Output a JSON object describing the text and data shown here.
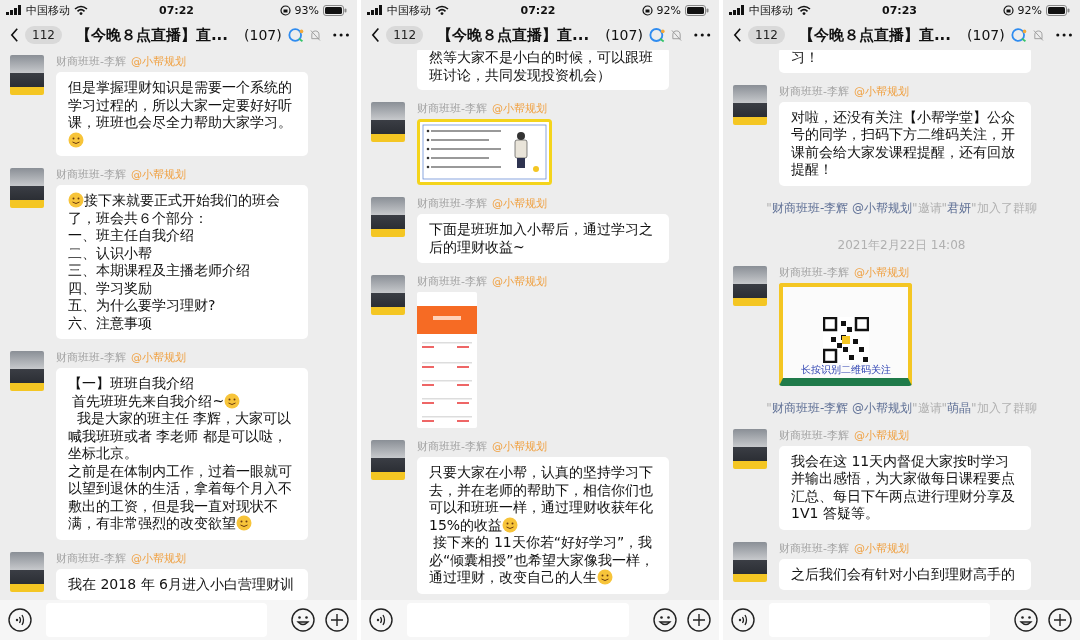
{
  "phones": [
    {
      "status": {
        "carrier": "中国移动",
        "time": "07:22",
        "battery": "93%"
      },
      "header": {
        "back_count": "112",
        "title": "【今晚８点直播】直...",
        "member_count": "(107)"
      },
      "messages": [
        {
          "kind": "text",
          "sender": "财商班班-李辉",
          "mention": "@小帮规划",
          "rows": [
            [
              "但是掌握理财知识是需要一个系统的学习过程的，所以大家一定要好好听课，班班也会尽全力帮助大家学习。"
            ],
            [
              {
                "kind": "emoji"
              }
            ]
          ]
        },
        {
          "kind": "text",
          "sender": "财商班班-李辉",
          "mention": "@小帮规划",
          "rows": [
            [
              {
                "kind": "emoji"
              },
              "接下来就要正式开始我们的班会"
            ],
            [
              "了，班会共６个部分："
            ],
            [
              "一、班主任自我介绍"
            ],
            [
              "二、认识小帮"
            ],
            [
              "三、本期课程及主播老师介绍"
            ],
            [
              "四、学习奖励"
            ],
            [
              "五、为什么要学习理财?"
            ],
            [
              "六、注意事项"
            ]
          ]
        },
        {
          "kind": "text",
          "sender": "财商班班-李辉",
          "mention": "@小帮规划",
          "rows": [
            [
              "【一】班班自我介绍"
            ],
            [
              " 首先班班先来自我介绍~",
              {
                "kind": "emoji"
              }
            ],
            [
              "  我是大家的班主任 李辉，大家可以喊我班班或者 李老师 都是可以哒，坐标北京。"
            ],
            [
              "之前是在体制内工作，过着一眼就可以望到退休的生活，拿着每个月入不敷出的工资，但是我一直对现状不"
            ],
            [
              "满，有非常强烈的改变欲望",
              {
                "kind": "emoji"
              }
            ]
          ]
        },
        {
          "kind": "text",
          "sender": "财商班班-李辉",
          "mention": "@小帮规划",
          "rows": [
            [
              "我在 2018 年 6月进入小白营理财训"
            ]
          ]
        }
      ]
    },
    {
      "status": {
        "carrier": "中国移动",
        "time": "07:22",
        "battery": "92%"
      },
      "header": {
        "back_count": "112",
        "title": "【今晚８点直播】直...",
        "member_count": "(107)"
      },
      "messages": [
        {
          "kind": "text",
          "rows": [
            [
              "然等大家不是小白的时候，可以跟班班讨论，共同发现投资机会）"
            ]
          ]
        },
        {
          "kind": "slide_image",
          "sender": "财商班班-李辉",
          "mention": "@小帮规划"
        },
        {
          "kind": "text",
          "sender": "财商班班-李辉",
          "mention": "@小帮规划",
          "rows": [
            [
              "下面是班班加入小帮后，通过学习之后的理财收益~"
            ]
          ]
        },
        {
          "kind": "screenshot_image",
          "sender": "财商班班-李辉",
          "mention": "@小帮规划"
        },
        {
          "kind": "text",
          "sender": "财商班班-李辉",
          "mention": "@小帮规划",
          "rows": [
            [
              "只要大家在小帮，认真的坚持学习下去，并在老师的帮助下，相信你们也可以和班班一样，通过理财收获年化"
            ],
            [
              "15%的收益",
              {
                "kind": "emoji"
              }
            ],
            [
              " 接下来的 11天你若“好好学习”，我必“倾囊相授”也希望大家像我一样，"
            ],
            [
              "通过理财，改变自己的人生",
              {
                "kind": "emoji"
              }
            ]
          ]
        }
      ]
    },
    {
      "status": {
        "carrier": "中国移动",
        "time": "07:23",
        "battery": "92%"
      },
      "header": {
        "back_count": "112",
        "title": "【今晚８点直播】直...",
        "member_count": "(107)"
      },
      "messages": [
        {
          "kind": "text",
          "rows": [
            [
              "习！"
            ]
          ]
        },
        {
          "kind": "text",
          "sender": "财商班班-李辉",
          "mention": "@小帮规划",
          "rows": [
            [
              "对啦，还没有关注【小帮学堂】公众号的同学，扫码下方二维码关注，开课前会给大家发课程提醒，还有回放提醒！"
            ]
          ]
        },
        {
          "kind": "system",
          "parts": [
            {
              "text": "\"",
              "link": false
            },
            {
              "text": "财商班班-李辉 @小帮规划",
              "link": true
            },
            {
              "text": "\"邀请\"",
              "link": false
            },
            {
              "text": "君妍",
              "link": true
            },
            {
              "text": "\"加入了群聊",
              "link": false
            }
          ]
        },
        {
          "kind": "time",
          "text": "2021年2月22日 14:08"
        },
        {
          "kind": "poster_image",
          "caption": "长按识别二维码关注",
          "sender": "财商班班-李辉",
          "mention": "@小帮规划"
        },
        {
          "kind": "system",
          "parts": [
            {
              "text": "\"",
              "link": false
            },
            {
              "text": "财商班班-李辉 @小帮规划",
              "link": true
            },
            {
              "text": "\"邀请\"",
              "link": false
            },
            {
              "text": "萌晶",
              "link": true
            },
            {
              "text": "\"加入了群聊",
              "link": false
            }
          ]
        },
        {
          "kind": "text",
          "sender": "财商班班-李辉",
          "mention": "@小帮规划",
          "rows": [
            [
              "我会在这 11天内督促大家按时学习并输出感悟，为大家做每日课程要点汇总、每日下午两点进行理财分享及 1V1 答疑等。"
            ]
          ]
        },
        {
          "kind": "text",
          "sender": "财商班班-李辉",
          "mention": "@小帮规划",
          "rows": [
            [
              "之后我们会有针对小白到理财高手的"
            ]
          ]
        }
      ]
    }
  ]
}
